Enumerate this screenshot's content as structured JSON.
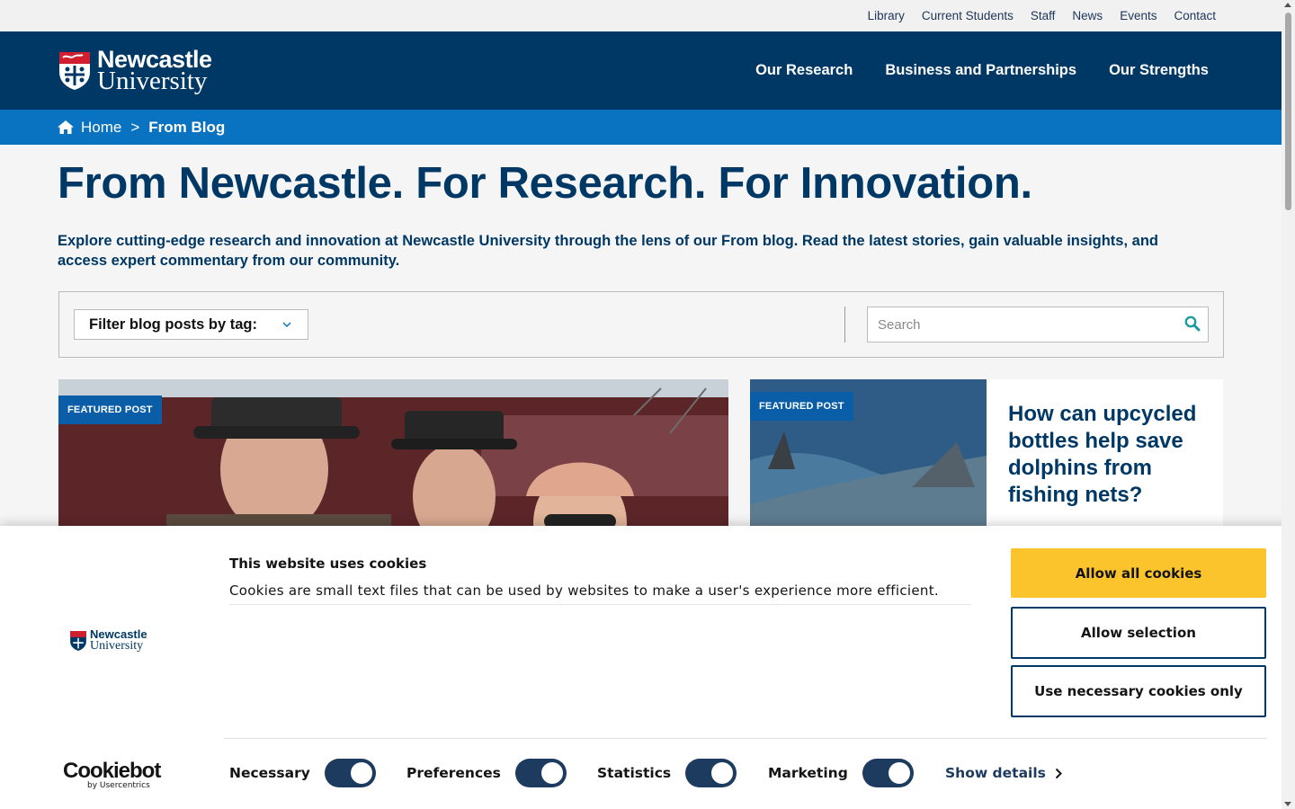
{
  "utility_nav": [
    "Library",
    "Current Students",
    "Staff",
    "News",
    "Events",
    "Contact"
  ],
  "logo": {
    "line1": "Newcastle",
    "line2": "University"
  },
  "main_nav": [
    "Our Research",
    "Business and Partnerships",
    "Our Strengths"
  ],
  "breadcrumb": {
    "home": "Home",
    "separator": ">",
    "current": "From Blog"
  },
  "page": {
    "title": "From Newcastle. For Research. For Innovation.",
    "intro": "Explore cutting-edge research and innovation at Newcastle University through the lens of our From blog. Read the latest stories, gain valuable insights, and access expert commentary from our community."
  },
  "filter": {
    "label": "Filter blog posts by tag:",
    "search_placeholder": "Search"
  },
  "featured": [
    {
      "badge": "FEATURED POST"
    },
    {
      "badge": "FEATURED POST",
      "title": "How can upcycled bottles help save dolphins from fishing nets?"
    }
  ],
  "cookie": {
    "title": "This website uses cookies",
    "text": "Cookies are small text files that can be used by websites to make a user's experience more efficient.",
    "allow_all": "Allow all cookies",
    "allow_selection": "Allow selection",
    "necessary_only": "Use necessary cookies only",
    "toggles": [
      "Necessary",
      "Preferences",
      "Statistics",
      "Marketing"
    ],
    "show_details": "Show details",
    "brand": "Cookiebot",
    "brand_sub": "by Usercentrics"
  },
  "colors": {
    "navy": "#003865",
    "blue": "#0a73c1",
    "yellow": "#fcc42c"
  }
}
